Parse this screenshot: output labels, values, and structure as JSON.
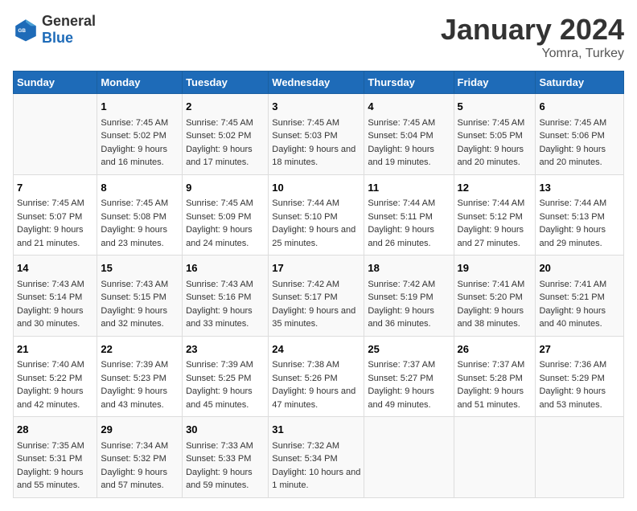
{
  "header": {
    "logo_general": "General",
    "logo_blue": "Blue",
    "title": "January 2024",
    "subtitle": "Yomra, Turkey"
  },
  "columns": [
    "Sunday",
    "Monday",
    "Tuesday",
    "Wednesday",
    "Thursday",
    "Friday",
    "Saturday"
  ],
  "weeks": [
    [
      {
        "day": "",
        "sunrise": "",
        "sunset": "",
        "daylight": ""
      },
      {
        "day": "1",
        "sunrise": "Sunrise: 7:45 AM",
        "sunset": "Sunset: 5:02 PM",
        "daylight": "Daylight: 9 hours and 16 minutes."
      },
      {
        "day": "2",
        "sunrise": "Sunrise: 7:45 AM",
        "sunset": "Sunset: 5:02 PM",
        "daylight": "Daylight: 9 hours and 17 minutes."
      },
      {
        "day": "3",
        "sunrise": "Sunrise: 7:45 AM",
        "sunset": "Sunset: 5:03 PM",
        "daylight": "Daylight: 9 hours and 18 minutes."
      },
      {
        "day": "4",
        "sunrise": "Sunrise: 7:45 AM",
        "sunset": "Sunset: 5:04 PM",
        "daylight": "Daylight: 9 hours and 19 minutes."
      },
      {
        "day": "5",
        "sunrise": "Sunrise: 7:45 AM",
        "sunset": "Sunset: 5:05 PM",
        "daylight": "Daylight: 9 hours and 20 minutes."
      },
      {
        "day": "6",
        "sunrise": "Sunrise: 7:45 AM",
        "sunset": "Sunset: 5:06 PM",
        "daylight": "Daylight: 9 hours and 20 minutes."
      }
    ],
    [
      {
        "day": "7",
        "sunrise": "Sunrise: 7:45 AM",
        "sunset": "Sunset: 5:07 PM",
        "daylight": "Daylight: 9 hours and 21 minutes."
      },
      {
        "day": "8",
        "sunrise": "Sunrise: 7:45 AM",
        "sunset": "Sunset: 5:08 PM",
        "daylight": "Daylight: 9 hours and 23 minutes."
      },
      {
        "day": "9",
        "sunrise": "Sunrise: 7:45 AM",
        "sunset": "Sunset: 5:09 PM",
        "daylight": "Daylight: 9 hours and 24 minutes."
      },
      {
        "day": "10",
        "sunrise": "Sunrise: 7:44 AM",
        "sunset": "Sunset: 5:10 PM",
        "daylight": "Daylight: 9 hours and 25 minutes."
      },
      {
        "day": "11",
        "sunrise": "Sunrise: 7:44 AM",
        "sunset": "Sunset: 5:11 PM",
        "daylight": "Daylight: 9 hours and 26 minutes."
      },
      {
        "day": "12",
        "sunrise": "Sunrise: 7:44 AM",
        "sunset": "Sunset: 5:12 PM",
        "daylight": "Daylight: 9 hours and 27 minutes."
      },
      {
        "day": "13",
        "sunrise": "Sunrise: 7:44 AM",
        "sunset": "Sunset: 5:13 PM",
        "daylight": "Daylight: 9 hours and 29 minutes."
      }
    ],
    [
      {
        "day": "14",
        "sunrise": "Sunrise: 7:43 AM",
        "sunset": "Sunset: 5:14 PM",
        "daylight": "Daylight: 9 hours and 30 minutes."
      },
      {
        "day": "15",
        "sunrise": "Sunrise: 7:43 AM",
        "sunset": "Sunset: 5:15 PM",
        "daylight": "Daylight: 9 hours and 32 minutes."
      },
      {
        "day": "16",
        "sunrise": "Sunrise: 7:43 AM",
        "sunset": "Sunset: 5:16 PM",
        "daylight": "Daylight: 9 hours and 33 minutes."
      },
      {
        "day": "17",
        "sunrise": "Sunrise: 7:42 AM",
        "sunset": "Sunset: 5:17 PM",
        "daylight": "Daylight: 9 hours and 35 minutes."
      },
      {
        "day": "18",
        "sunrise": "Sunrise: 7:42 AM",
        "sunset": "Sunset: 5:19 PM",
        "daylight": "Daylight: 9 hours and 36 minutes."
      },
      {
        "day": "19",
        "sunrise": "Sunrise: 7:41 AM",
        "sunset": "Sunset: 5:20 PM",
        "daylight": "Daylight: 9 hours and 38 minutes."
      },
      {
        "day": "20",
        "sunrise": "Sunrise: 7:41 AM",
        "sunset": "Sunset: 5:21 PM",
        "daylight": "Daylight: 9 hours and 40 minutes."
      }
    ],
    [
      {
        "day": "21",
        "sunrise": "Sunrise: 7:40 AM",
        "sunset": "Sunset: 5:22 PM",
        "daylight": "Daylight: 9 hours and 42 minutes."
      },
      {
        "day": "22",
        "sunrise": "Sunrise: 7:39 AM",
        "sunset": "Sunset: 5:23 PM",
        "daylight": "Daylight: 9 hours and 43 minutes."
      },
      {
        "day": "23",
        "sunrise": "Sunrise: 7:39 AM",
        "sunset": "Sunset: 5:25 PM",
        "daylight": "Daylight: 9 hours and 45 minutes."
      },
      {
        "day": "24",
        "sunrise": "Sunrise: 7:38 AM",
        "sunset": "Sunset: 5:26 PM",
        "daylight": "Daylight: 9 hours and 47 minutes."
      },
      {
        "day": "25",
        "sunrise": "Sunrise: 7:37 AM",
        "sunset": "Sunset: 5:27 PM",
        "daylight": "Daylight: 9 hours and 49 minutes."
      },
      {
        "day": "26",
        "sunrise": "Sunrise: 7:37 AM",
        "sunset": "Sunset: 5:28 PM",
        "daylight": "Daylight: 9 hours and 51 minutes."
      },
      {
        "day": "27",
        "sunrise": "Sunrise: 7:36 AM",
        "sunset": "Sunset: 5:29 PM",
        "daylight": "Daylight: 9 hours and 53 minutes."
      }
    ],
    [
      {
        "day": "28",
        "sunrise": "Sunrise: 7:35 AM",
        "sunset": "Sunset: 5:31 PM",
        "daylight": "Daylight: 9 hours and 55 minutes."
      },
      {
        "day": "29",
        "sunrise": "Sunrise: 7:34 AM",
        "sunset": "Sunset: 5:32 PM",
        "daylight": "Daylight: 9 hours and 57 minutes."
      },
      {
        "day": "30",
        "sunrise": "Sunrise: 7:33 AM",
        "sunset": "Sunset: 5:33 PM",
        "daylight": "Daylight: 9 hours and 59 minutes."
      },
      {
        "day": "31",
        "sunrise": "Sunrise: 7:32 AM",
        "sunset": "Sunset: 5:34 PM",
        "daylight": "Daylight: 10 hours and 1 minute."
      },
      {
        "day": "",
        "sunrise": "",
        "sunset": "",
        "daylight": ""
      },
      {
        "day": "",
        "sunrise": "",
        "sunset": "",
        "daylight": ""
      },
      {
        "day": "",
        "sunrise": "",
        "sunset": "",
        "daylight": ""
      }
    ]
  ]
}
